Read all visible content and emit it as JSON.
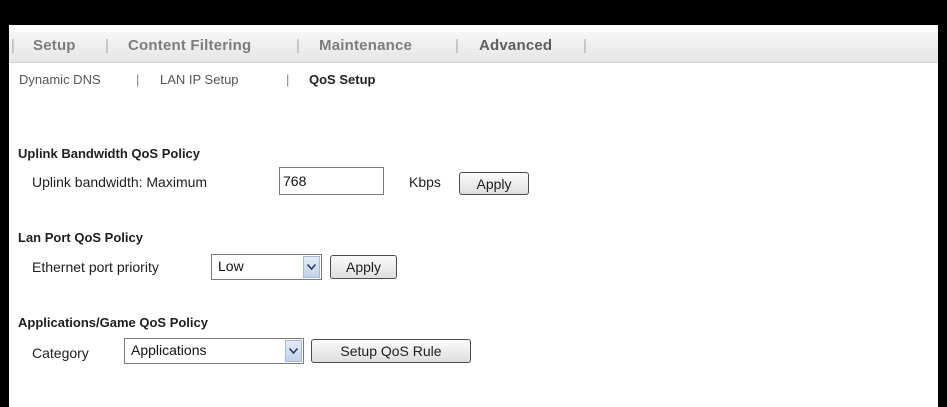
{
  "topnav": {
    "items": [
      "Setup",
      "Content Filtering",
      "Maintenance",
      "Advanced"
    ],
    "active": "Advanced"
  },
  "subnav": {
    "items": [
      "Dynamic DNS",
      "LAN IP Setup",
      "QoS Setup"
    ],
    "active": "QoS Setup"
  },
  "uplink": {
    "title": "Uplink Bandwidth QoS Policy",
    "label": "Uplink bandwidth: Maximum",
    "value": "768",
    "unit": "Kbps",
    "apply_label": "Apply"
  },
  "lan": {
    "title": "Lan Port QoS Policy",
    "label": "Ethernet port priority",
    "selected": "Low",
    "apply_label": "Apply"
  },
  "apps": {
    "title": "Applications/Game QoS Policy",
    "label": "Category",
    "selected": "Applications",
    "rule_label": "Setup QoS Rule"
  }
}
